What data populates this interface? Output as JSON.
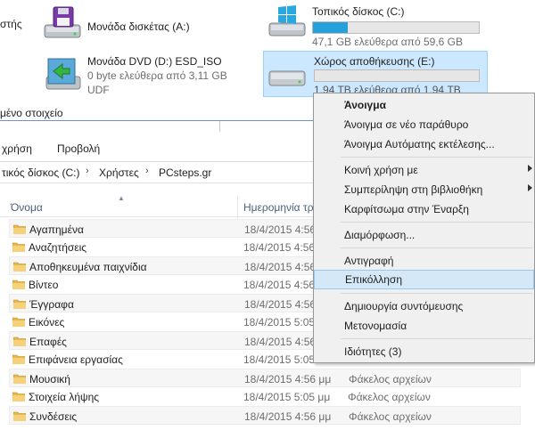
{
  "drives": {
    "cutoff_text": "στής",
    "floppy": {
      "name": "Μονάδα δισκέτας (A:)"
    },
    "dvd": {
      "name": "Μονάδα DVD (D:) ESD_ISO",
      "sub1": "0 byte ελεύθερα από 3,11 GB",
      "sub2": "UDF"
    },
    "local_c": {
      "name": "Τοπικός δίσκος (C:)",
      "free": "47,1 GB ελεύθερα από 59,6 GB",
      "usage_fraction": 0.21
    },
    "storage_e": {
      "name": "Χώρος αποθήκευσης (E:)",
      "free": "1,94 TB ελεύθερα από 1,94 TB",
      "usage_fraction": 0.0
    }
  },
  "status": {
    "selected": "μένο στοιχείο"
  },
  "ribbon": {
    "tab_share": "χρήση",
    "tab_view": "Προβολή"
  },
  "address": {
    "crumbs": [
      "τικός δίσκος (C:)",
      "Χρήστες",
      "PCsteps.gr"
    ]
  },
  "columns": {
    "name": "Όνομα",
    "date": "Ημερομηνία τρ"
  },
  "rows": [
    {
      "name": "Αγαπημένα",
      "date": "18/4/2015 4:56",
      "type": ""
    },
    {
      "name": "Αναζητήσεις",
      "date": "18/4/2015 4:56",
      "type": ""
    },
    {
      "name": "Αποθηκευμένα παιχνίδια",
      "date": "18/4/2015 4:56",
      "type": ""
    },
    {
      "name": "Βίντεο",
      "date": "18/4/2015 4:56",
      "type": ""
    },
    {
      "name": "Έγγραφα",
      "date": "18/4/2015 4:56",
      "type": ""
    },
    {
      "name": "Εικόνες",
      "date": "18/4/2015 5:05",
      "type": ""
    },
    {
      "name": "Επαφές",
      "date": "18/4/2015 4:56",
      "type": ""
    },
    {
      "name": "Επιφάνεια εργασίας",
      "date": "18/4/2015 5:05",
      "type": ""
    },
    {
      "name": "Μουσική",
      "date": "18/4/2015 4:56 μμ",
      "type": "Φάκελος αρχείων"
    },
    {
      "name": "Στοιχεία λήψης",
      "date": "18/4/2015 5:05 μμ",
      "type": "Φάκελος αρχείων"
    },
    {
      "name": "Συνδέσεις",
      "date": "18/4/2015 4:56 μμ",
      "type": "Φάκελος αρχείων"
    }
  ],
  "context_menu": {
    "open": "Άνοιγμα",
    "open_new_window": "Άνοιγμα σε νέο παράθυρο",
    "open_autoplay": "Άνοιγμα Αυτόματης εκτέλεσης...",
    "share_with": "Κοινή χρήση με",
    "include_in_library": "Συμπερίληψη στη βιβλιοθήκη",
    "pin_to_start": "Καρφίτσωμα στην Έναρξη",
    "format": "Διαμόρφωση...",
    "copy": "Αντιγραφή",
    "paste": "Επικόλληση",
    "create_shortcut": "Δημιουργία συντόμευσης",
    "rename": "Μετονομασία",
    "properties": "Ιδιότητες (3)"
  },
  "colors": {
    "accent": "#26a0da",
    "selection": "#cce8ff",
    "menu_highlight": "#d5e8f8",
    "folder": "#e8b84a"
  }
}
